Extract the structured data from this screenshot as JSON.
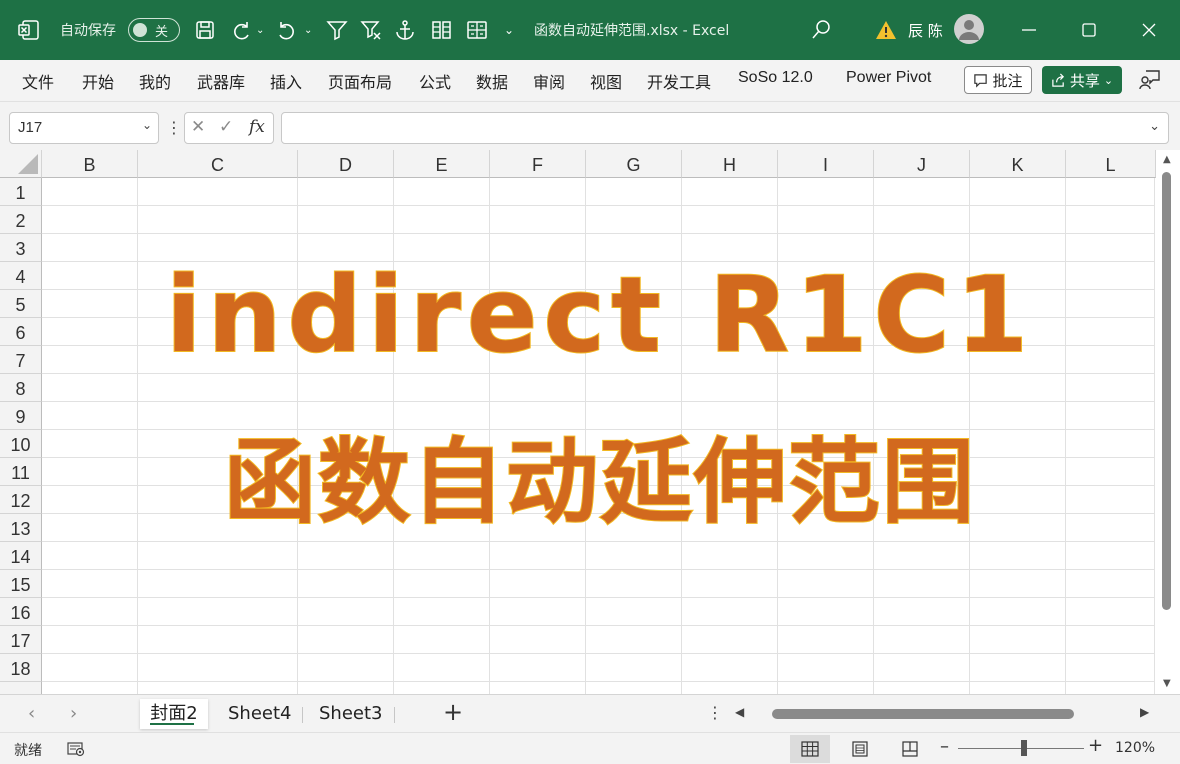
{
  "titlebar": {
    "autosave_label": "自动保存",
    "autosave_state": "关",
    "filename": "函数自动延伸范围.xlsx  -  Excel",
    "user_name": "辰 陈"
  },
  "ribbon": {
    "tabs": [
      "文件",
      "开始",
      "我的",
      "武器库",
      "插入",
      "页面布局",
      "公式",
      "数据",
      "审阅",
      "视图",
      "开发工具",
      "SoSo 12.0",
      "Power Pivot"
    ],
    "comments_label": "批注",
    "share_label": "共享"
  },
  "formula_bar": {
    "name_box": "J17",
    "formula": ""
  },
  "grid": {
    "columns": [
      "B",
      "C",
      "D",
      "E",
      "F",
      "G",
      "H",
      "I",
      "J",
      "K",
      "L"
    ],
    "rows": [
      "1",
      "2",
      "3",
      "4",
      "5",
      "6",
      "7",
      "8",
      "9",
      "10",
      "11",
      "12",
      "13",
      "14",
      "15",
      "16",
      "17",
      "18"
    ],
    "title_line1": "indirect R1C1",
    "title_line2": "函数自动延伸范围"
  },
  "sheets": {
    "tabs": [
      "封面2",
      "Sheet4",
      "Sheet3"
    ],
    "active": "封面2"
  },
  "statusbar": {
    "status": "就绪",
    "zoom": "120%"
  },
  "colors": {
    "excel_green": "#1e7145",
    "title_fill": "#d2691e",
    "title_stroke": "#f2b822"
  }
}
